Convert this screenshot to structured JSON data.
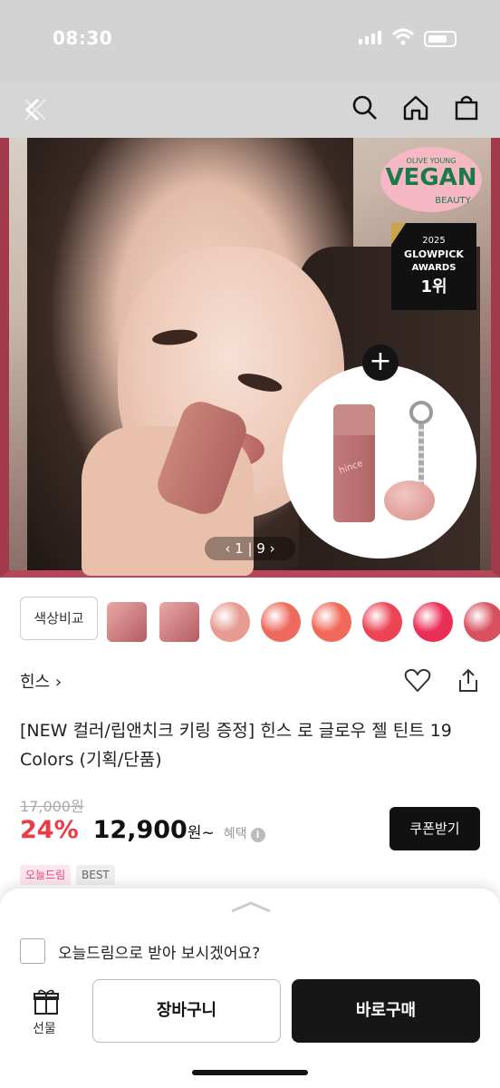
{
  "status_bar": {
    "time": "08:30"
  },
  "hero": {
    "vegan_badge": {
      "top": "OLIVE YOUNG",
      "main": "VEGAN",
      "sub": "BEAUTY"
    },
    "award": {
      "year": "2025",
      "line1": "GLOWPICK",
      "line2": "AWARDS",
      "rank": "1위"
    },
    "gift_plus": "+",
    "product_label": "hince",
    "pager": "‹  1 | 9  ›"
  },
  "color_strip": {
    "compare_label": "색상비교",
    "swatches": [
      "#e89b90",
      "#ef6a5e",
      "#f06958",
      "#ec4455",
      "#ea2e56",
      "#d9505f"
    ]
  },
  "product": {
    "brand": "힌스 ›",
    "title": "[NEW 컬러/립앤치크 키링 증정] 힌스 로 글로우 젤 틴트 19 Colors (기획/단품)",
    "original_price": "17,000원",
    "discount": "24%",
    "price": "12,900",
    "price_unit": "원~",
    "benefit_label": "혜택",
    "coupon_label": "쿠폰받기",
    "badges": [
      "오늘드림",
      "BEST"
    ]
  },
  "sheet": {
    "checkbox_label": "오늘드림으로 받아 보시겠어요?",
    "gift_label": "선물",
    "cart_label": "장바구니",
    "buy_label": "바로구매"
  },
  "colors": {
    "accent_red": "#ef3a46",
    "dark": "#161616",
    "frame": "#a33a4c"
  }
}
